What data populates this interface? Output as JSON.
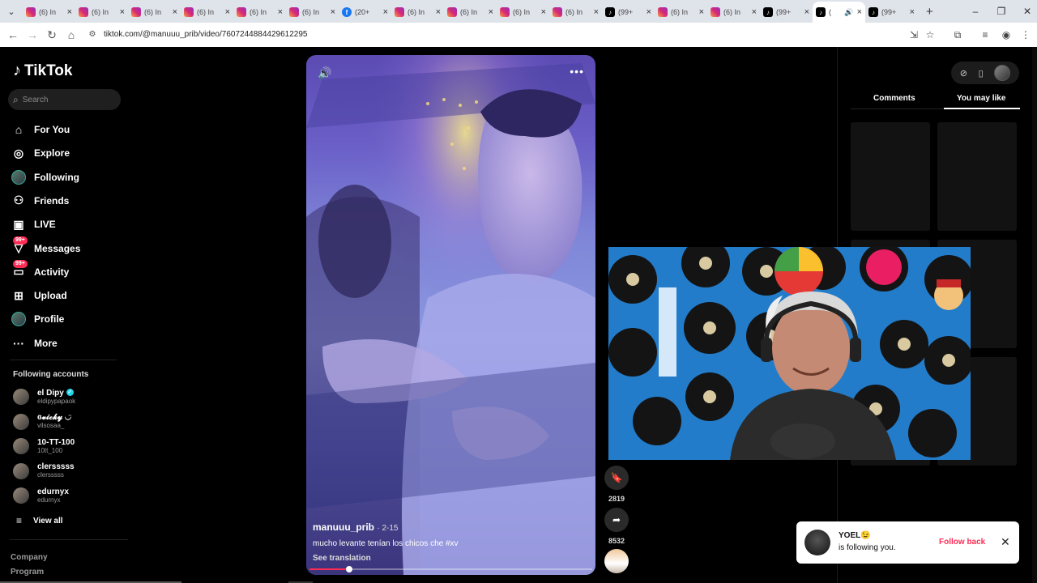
{
  "browser": {
    "tabs": [
      {
        "icon": "instagram",
        "label": "(6) In",
        "active": false
      },
      {
        "icon": "instagram",
        "label": "(6) In",
        "active": false
      },
      {
        "icon": "instagram",
        "label": "(6) In",
        "active": false
      },
      {
        "icon": "instagram",
        "label": "(6) In",
        "active": false
      },
      {
        "icon": "instagram",
        "label": "(6) In",
        "active": false
      },
      {
        "icon": "instagram",
        "label": "(6) In",
        "active": false
      },
      {
        "icon": "facebook",
        "label": "(20+",
        "active": false
      },
      {
        "icon": "instagram",
        "label": "(6) In",
        "active": false
      },
      {
        "icon": "instagram",
        "label": "(6) In",
        "active": false
      },
      {
        "icon": "instagram",
        "label": "(6) In",
        "active": false
      },
      {
        "icon": "instagram",
        "label": "(6) In",
        "active": false
      },
      {
        "icon": "tiktok",
        "label": "(99+",
        "active": false
      },
      {
        "icon": "instagram",
        "label": "(6) In",
        "active": false
      },
      {
        "icon": "instagram",
        "label": "(6) In",
        "active": false
      },
      {
        "icon": "tiktok",
        "label": "(99+",
        "active": false
      },
      {
        "icon": "tiktok",
        "label": "(",
        "active": true
      },
      {
        "icon": "tiktok",
        "label": "(99+",
        "active": false
      }
    ],
    "url": "tiktok.com/@manuuu_prib/video/7607244884429612295"
  },
  "sidebar": {
    "logo": "TikTok",
    "search_placeholder": "Search",
    "nav": [
      {
        "label": "For You",
        "icon": "home-icon"
      },
      {
        "label": "Explore",
        "icon": "compass-icon"
      },
      {
        "label": "Following",
        "icon": "avatar"
      },
      {
        "label": "Friends",
        "icon": "friends-icon"
      },
      {
        "label": "LIVE",
        "icon": "live-icon"
      },
      {
        "label": "Messages",
        "icon": "messages-icon",
        "badge": "99+"
      },
      {
        "label": "Activity",
        "icon": "activity-icon",
        "badge": "99+"
      },
      {
        "label": "Upload",
        "icon": "upload-icon"
      },
      {
        "label": "Profile",
        "icon": "avatar"
      },
      {
        "label": "More",
        "icon": "more-icon"
      }
    ],
    "following_title": "Following accounts",
    "accounts": [
      {
        "name": "el Dipy",
        "username": "eldipypapaok",
        "verified": true
      },
      {
        "name": "ɞ𝓿𝓲𝓬𝓴𝔂 ◡̈",
        "username": "vilsosaa_",
        "verified": false
      },
      {
        "name": "10-TT-100",
        "username": "10tt_100",
        "verified": false
      },
      {
        "name": "clersssss",
        "username": "clersssss",
        "verified": false
      },
      {
        "name": "edurnyx",
        "username": "edurnyx",
        "verified": false
      }
    ],
    "view_all": "View all",
    "footer": [
      "Company",
      "Program"
    ]
  },
  "video": {
    "username": "manuuu_prib",
    "date": "· 2-15",
    "caption": "mucho levante tenían los chicos che #xv",
    "see_translation": "See translation",
    "progress": 0.14
  },
  "actions": {
    "saves": "2819",
    "shares": "8532"
  },
  "right_panel": {
    "tabs": [
      "Comments",
      "You may like"
    ],
    "active_tab": "You may like"
  },
  "toast": {
    "name": "YOEL😉",
    "message": "is following you.",
    "follow_back": "Follow back"
  },
  "colors": {
    "accent": "#fe2c55",
    "verified": "#20d5ec",
    "background": "#000000"
  }
}
